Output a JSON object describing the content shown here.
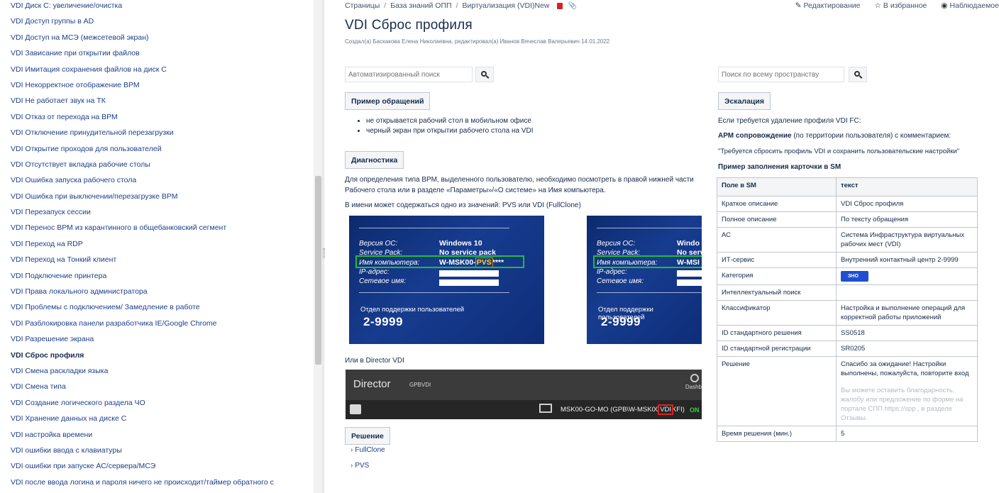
{
  "sidebar": {
    "items": [
      {
        "label": "VDI Диск С: увеличение/очистка"
      },
      {
        "label": "VDI Доступ группы в AD"
      },
      {
        "label": "VDI Доступ на МСЭ (межсетевой экран)"
      },
      {
        "label": "VDI Зависание при открытии файлов"
      },
      {
        "label": "VDI Имитация сохранения файлов на диск С"
      },
      {
        "label": "VDI Некорректное отображение ВРМ"
      },
      {
        "label": "VDI Не работает звук на ТК"
      },
      {
        "label": "VDI Отказ от перехода на ВРМ"
      },
      {
        "label": "VDI Отключение принудительной перезагрузки"
      },
      {
        "label": "VDI Открытие проходов для пользователей"
      },
      {
        "label": "VDI Отсутствует вкладка рабочие столы"
      },
      {
        "label": "VDI Ошибка запуска рабочего стола"
      },
      {
        "label": "VDI Ошибка при выключении/перезагрузке ВРМ"
      },
      {
        "label": "VDI Перезапуск сессии"
      },
      {
        "label": "VDI Перенос ВРМ из карантинного в общебанковский сегмент"
      },
      {
        "label": "VDI Переход на RDP"
      },
      {
        "label": "VDI Переход на Тонкий клиент"
      },
      {
        "label": "VDI Подключение принтера"
      },
      {
        "label": "VDI Права локального администратора"
      },
      {
        "label": "VDI Проблемы с подключением/ Замедление в работе"
      },
      {
        "label": "VDI Разблокировка панели разработчика IE/Google Chrome"
      },
      {
        "label": "VDI Разрешение экрана"
      },
      {
        "label": "VDI Сброс профиля",
        "active": true
      },
      {
        "label": "VDI Смена раскладки языка"
      },
      {
        "label": "VDI Смена типа"
      },
      {
        "label": "VDI Создание логического раздела ЧО"
      },
      {
        "label": "VDI Хранение данных на диске С"
      },
      {
        "label": "VDI настройка времени"
      },
      {
        "label": "VDI ошибки ввода с клавиатуры"
      },
      {
        "label": "VDI ошибки при запуске АС/сервера/МСЭ"
      },
      {
        "label": "VDI после ввода логина и пароля ничего не происходит/таймер обратного с"
      }
    ]
  },
  "breadcrumb": {
    "items": [
      "Страницы",
      "База знаний ОПП",
      "Виртуализация (VDI)New"
    ],
    "separator": "/"
  },
  "actions": {
    "edit": "Редактирование",
    "favorite": "В избранное",
    "watch": "Наблюдаемое"
  },
  "page": {
    "title": "VDI Сброс профиля",
    "byline": "Создал(а) Баскакова Елена Николаевна, редактировал(а) Иванов Вячеслав Валерьевич 14.01.2022"
  },
  "search": {
    "auto_placeholder": "Автоматизированный поиск",
    "space_placeholder": "Поиск по всему пространству"
  },
  "left_content": {
    "requests_btn": "Пример обращений",
    "requests": [
      "не открывается рабочий стол в мобильном офисе",
      "черный экран при открытии рабочего стола на VDI"
    ],
    "diag_btn": "Диагностика",
    "diag_text": "Для определения типа ВРМ, выделенного пользователю, необходимо посмотреть в правой нижней части Рабочего стола или в разделе «Параметры»/«О системе» на Имя компьютера.",
    "diag_text2": "В имени может содержаться одно из значений: PVS или VDI (FullClone)",
    "screen": {
      "os_label": "Версия ОС:",
      "sp_label": "Service Pack:",
      "name_label": "Имя компьютера:",
      "ip_label": "IP-адрес:",
      "net_label": "Сетевое имя:",
      "os_val": "Windows 10",
      "os_val_cut": "Windo",
      "sp_val": "No service pack",
      "name_val": "W-MSK00-",
      "name_val_cut": "W-MSI",
      "pvs": "PVS",
      "stars": "****",
      "support": "Отдел поддержки пользователей",
      "phone": "2-9999"
    },
    "director_caption": "Или в Director VDI",
    "director": {
      "title": "Director",
      "site": "GPBVDI",
      "dash": "Dashb",
      "host_pre": "MSK00-GO-MO (GPB\\W-MSK00",
      "host_vdi": "VDI",
      "host_post": "KFI)",
      "status": "ON"
    },
    "solution_btn": "Решение",
    "links": [
      "FullClone",
      "PVS"
    ]
  },
  "right_content": {
    "escalation_btn": "Эскалация",
    "line1": "Если требуется удаление профиля VDI FC:",
    "line2_bold": "АРМ сопровождение",
    "line2_rest": " (по территории пользователя) с комментарием:",
    "line3": "\"Требуется сбросить профиль VDI и сохранить пользовательские настройки\"",
    "table_title": "Пример заполнения карточки в SM",
    "table_headers": [
      "Поле в SM",
      "текст"
    ],
    "rows": [
      {
        "k": "Краткое описание",
        "v": "VDI Сброс профиля"
      },
      {
        "k": "Полное описание",
        "v": "По тексту обращения"
      },
      {
        "k": "АС",
        "v": "Система Инфраструктура виртуальных рабочих мест (VDI)"
      },
      {
        "k": "ИТ-сервис",
        "v": "Внутренний контактный центр 2-9999"
      },
      {
        "k": "Категория",
        "v": "ЗНО"
      },
      {
        "k": "Интеллектуальный поиск",
        "v": ""
      },
      {
        "k": "Классификатор",
        "v": "Настройка и выполнение операций для корректной работы приложений"
      },
      {
        "k": "ID стандартного решения",
        "v": "SS0518"
      },
      {
        "k": "ID стандартной регистрации",
        "v": "SR0205"
      },
      {
        "k": "Решение",
        "v": "Спасибо за ожидание! Настройки выполнены, пожалуйста, повторите вход",
        "muted": "Вы можете оставить благодарность, жалобу или предложение по форме на портале СПП https://spp , в разделе Отзывы."
      },
      {
        "k": "Время решения (мин.)",
        "v": "5"
      }
    ]
  },
  "colors": {
    "link": "#1d3f8a",
    "badge": "#1f4fcf",
    "highlight_green": "#1fbf3a",
    "highlight_red": "#e02020"
  }
}
